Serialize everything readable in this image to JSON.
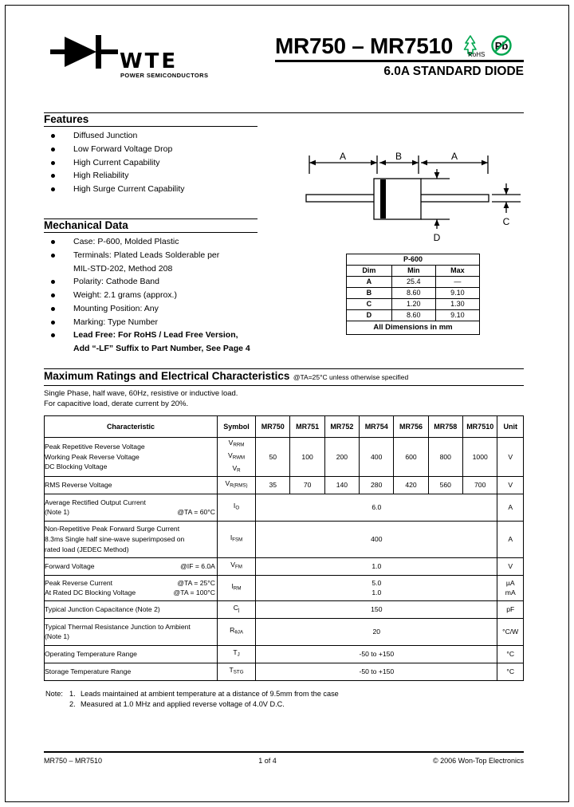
{
  "header": {
    "logo_text": "WTE",
    "logo_subtext": "POWER SEMICONDUCTORS",
    "logo_icon": "diode-symbol-icon",
    "title": "MR750 – MR7510",
    "subtitle": "6.0A STANDARD DIODE",
    "rohs_label": "RoHS",
    "rohs_icon": "rohs-tree-icon",
    "pb_label": "Pb",
    "pb_icon": "lead-free-icon",
    "accent_color": "#00a64f"
  },
  "features": {
    "title": "Features",
    "items": [
      "Diffused Junction",
      "Low Forward Voltage Drop",
      "High Current Capability",
      "High Reliability",
      "High Surge Current Capability"
    ]
  },
  "mechanical": {
    "title": "Mechanical Data",
    "items": [
      {
        "text": "Case: P-600, Molded Plastic",
        "bold": false
      },
      {
        "text": "Terminals: Plated Leads Solderable per",
        "bold": false
      },
      {
        "text": "MIL-STD-202, Method 208",
        "bold": false,
        "continuation": true
      },
      {
        "text": "Polarity: Cathode Band",
        "bold": false
      },
      {
        "text": "Weight: 2.1 grams (approx.)",
        "bold": false
      },
      {
        "text": "Mounting Position: Any",
        "bold": false
      },
      {
        "text": "Marking: Type Number",
        "bold": false
      },
      {
        "text": "Lead Free: For RoHS / Lead Free Version,",
        "bold": true
      },
      {
        "text": "Add “-LF” Suffix to Part Number, See Page 4",
        "bold": true,
        "continuation": true
      }
    ]
  },
  "package_drawing": {
    "labels": {
      "a_left": "A",
      "b": "B",
      "a_right": "A",
      "c": "C",
      "d": "D"
    }
  },
  "dimensions_table": {
    "title": "P-600",
    "columns": [
      "Dim",
      "Min",
      "Max"
    ],
    "rows": [
      {
        "dim": "A",
        "min": "25.4",
        "max": "—"
      },
      {
        "dim": "B",
        "min": "8.60",
        "max": "9.10"
      },
      {
        "dim": "C",
        "min": "1.20",
        "max": "1.30"
      },
      {
        "dim": "D",
        "min": "8.60",
        "max": "9.10"
      }
    ],
    "footer": "All Dimensions in mm"
  },
  "ratings": {
    "title": "Maximum Ratings and Electrical Characteristics",
    "condition": "@TA=25°C unless otherwise specified",
    "note_line1": "Single Phase, half wave, 60Hz, resistive or inductive load.",
    "note_line2": "For capacitive load, derate current by 20%."
  },
  "spec_table": {
    "columns": [
      "Characteristic",
      "Symbol",
      "MR750",
      "MR751",
      "MR752",
      "MR754",
      "MR756",
      "MR758",
      "MR7510",
      "Unit"
    ],
    "rows": [
      {
        "characteristic_lines": [
          {
            "text": "Peak Repetitive Reverse Voltage",
            "cond": ""
          },
          {
            "text": "Working Peak Reverse Voltage",
            "cond": ""
          },
          {
            "text": "DC Blocking Voltage",
            "cond": ""
          }
        ],
        "symbol_lines": [
          "VRRM",
          "VRWM",
          "VR"
        ],
        "values": [
          "50",
          "100",
          "200",
          "400",
          "600",
          "800",
          "1000"
        ],
        "unit": "V"
      },
      {
        "characteristic_lines": [
          {
            "text": "RMS Reverse Voltage",
            "cond": ""
          }
        ],
        "symbol_lines": [
          "VR(RMS)"
        ],
        "values": [
          "35",
          "70",
          "140",
          "280",
          "420",
          "560",
          "700"
        ],
        "unit": "V"
      },
      {
        "characteristic_lines": [
          {
            "text": "Average Rectified Output Current",
            "cond": ""
          },
          {
            "text": "(Note 1)",
            "cond": "@TA = 60°C"
          }
        ],
        "symbol_lines": [
          "IO"
        ],
        "span_value": "6.0",
        "unit": "A"
      },
      {
        "characteristic_lines": [
          {
            "text": "Non-Repetitive Peak Forward Surge Current",
            "cond": ""
          },
          {
            "text": "8.3ms Single half sine-wave superimposed on",
            "cond": ""
          },
          {
            "text": "rated load (JEDEC Method)",
            "cond": ""
          }
        ],
        "symbol_lines": [
          "IFSM"
        ],
        "span_value": "400",
        "unit": "A"
      },
      {
        "characteristic_lines": [
          {
            "text": "Forward Voltage",
            "cond": "@IF = 6.0A"
          }
        ],
        "symbol_lines": [
          "VFM"
        ],
        "span_value": "1.0",
        "unit": "V"
      },
      {
        "characteristic_lines": [
          {
            "text": "Peak Reverse Current",
            "cond": "@TA = 25°C"
          },
          {
            "text": "At Rated DC Blocking Voltage",
            "cond": "@TA = 100°C"
          }
        ],
        "symbol_lines": [
          "IRM"
        ],
        "span_value_lines": [
          "5.0",
          "1.0"
        ],
        "unit_lines": [
          "µA",
          "mA"
        ]
      },
      {
        "characteristic_lines": [
          {
            "text": "Typical Junction Capacitance (Note 2)",
            "cond": ""
          }
        ],
        "symbol_lines": [
          "Cj"
        ],
        "span_value": "150",
        "unit": "pF"
      },
      {
        "characteristic_lines": [
          {
            "text": "Typical Thermal Resistance Junction to Ambient",
            "cond": ""
          },
          {
            "text": "(Note 1)",
            "cond": ""
          }
        ],
        "symbol_lines": [
          "RθJA"
        ],
        "span_value": "20",
        "unit": "°C/W"
      },
      {
        "characteristic_lines": [
          {
            "text": "Operating Temperature Range",
            "cond": ""
          }
        ],
        "symbol_lines": [
          "TJ"
        ],
        "span_value": "-50 to +150",
        "unit": "°C"
      },
      {
        "characteristic_lines": [
          {
            "text": "Storage Temperature Range",
            "cond": ""
          }
        ],
        "symbol_lines": [
          "TSTG"
        ],
        "span_value": "-50 to +150",
        "unit": "°C"
      }
    ]
  },
  "notes": {
    "label": "Note:",
    "items": [
      {
        "num": "1.",
        "text": "Leads maintained at ambient temperature at a distance of 9.5mm from the case"
      },
      {
        "num": "2.",
        "text": "Measured at 1.0 MHz and applied reverse voltage of 4.0V D.C."
      }
    ]
  },
  "footer": {
    "left": "MR750 – MR7510",
    "center": "1 of 4",
    "right": "© 2006 Won-Top Electronics"
  }
}
